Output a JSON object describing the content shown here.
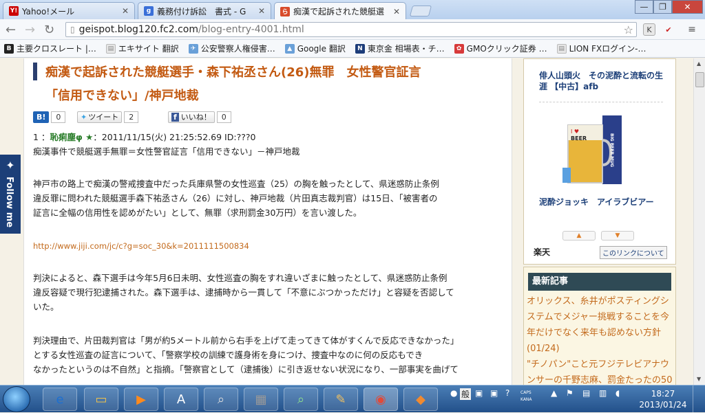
{
  "tabs": [
    {
      "title": "Yahoo!メール",
      "icon": "yahoo-icon",
      "color": "#cc0000",
      "glyph": "Y!"
    },
    {
      "title": "義務付け訴訟　書式 - G",
      "icon": "google-icon",
      "color": "#3a6fd8",
      "glyph": "g"
    },
    {
      "title": "痴漢で起訴された競艇選",
      "icon": "blog-icon",
      "color": "#d84b2a",
      "glyph": "ら"
    }
  ],
  "address": {
    "host": "geispot.blog120.fc2.com",
    "path": "/blog-entry-4001.html"
  },
  "bookmarks": [
    {
      "label": "主要クロスレート |…",
      "color": "#222",
      "glyph": "B"
    },
    {
      "label": "エキサイト 翻訳",
      "color": "#e6e6e6",
      "glyph": "📄"
    },
    {
      "label": "公安警察人権侵害…",
      "color": "#6aa0d8",
      "glyph": "✈"
    },
    {
      "label": "Google 翻訳",
      "color": "#6aa0d8",
      "glyph": "🚗"
    },
    {
      "label": "東京金 相場表・チ…",
      "color": "#1d3d7a",
      "glyph": "N"
    },
    {
      "label": "GMOクリック証券 …",
      "color": "#d73a3a",
      "glyph": "✿"
    },
    {
      "label": "LION FXログイン-…",
      "color": "#e6e6e6",
      "glyph": "📄"
    }
  ],
  "article": {
    "title_line1": "痴漢で起訴された競艇選手・森下祐丞さん(26)無罪　女性警官証言",
    "title_line2": "「信用できない」/神戸地裁",
    "hatena_label": "B!",
    "hatena_count": "0",
    "tweet_label": "ツイート",
    "tweet_count": "2",
    "like_label": "いいね！",
    "like_count": "0",
    "post_number": "1 ：",
    "poster_name": "恥痢塵φ ★",
    "post_date": "：2011/11/15(火) 21:25:52.69 ID:???0",
    "summary": "痴漢事件で競艇選手無罪＝女性警官証言「信用できない」－神戸地裁",
    "para1_l1": "神戸市の路上で痴漢の警戒捜査中だった兵庫県警の女性巡査（25）の胸を触ったとして、県迷惑防止条例",
    "para1_l2": "違反罪に問われた競艇選手森下祐丞さん（26）に対し、神戸地裁（片田真志裁判官）は15日、「被害者の",
    "para1_l3": "証言に全幅の信用性を認めがたい」として、無罪（求刑罰金30万円）を言い渡した。",
    "link": "http://www.jiji.com/jc/c?g=soc_30&k=2011111500834",
    "para2_l1": "判決によると、森下選手は今年5月6日未明、女性巡査の胸をすれ違いざまに触ったとして、県迷惑防止条例",
    "para2_l2": "違反容疑で現行犯逮捕された。森下選手は、逮捕時から一貫して「不意にぶつかっただけ」と容疑を否認して",
    "para2_l3": "いた。",
    "para3_l1": "判決理由で、片田裁判官は「男が約5メートル前から右手を上げて走ってきて体がすくんで反応できなかった」",
    "para3_l2": "とする女性巡査の証言について、「警察学校の訓練で護身術を身につけ、捜査中なのに何の反応もでき",
    "para3_l3": "なかったというのは不自然」と指摘。「警察官として（逮捕後）に引き返せない状況になり、一部事実を曲げて"
  },
  "follow_me": "Follow me",
  "sidebar": {
    "product1": "俳人山頭火　その泥酔と流転の生涯 【中古】afb",
    "product2": "泥酔ジョッキ　アイラブビアー",
    "beer_text": "BEER",
    "mug_text": "BIG BEER MUG",
    "rakuten": "楽天",
    "rakuten_link": "このリンクについて",
    "news_header": "最新記事",
    "news1": "オリックス、糸井がポスティングシステムでメジャー挑戦することを今年だけでなく来年も認めない方針(01/24)",
    "news2": "\"チノパン\"こと元フジテレビアナウンサーの千野志麻、罰金たったの50"
  },
  "taskbar": {
    "ime": "般",
    "caps": "CAPS",
    "kana": "KANA",
    "time": "18:27",
    "date": "2013/01/24"
  }
}
